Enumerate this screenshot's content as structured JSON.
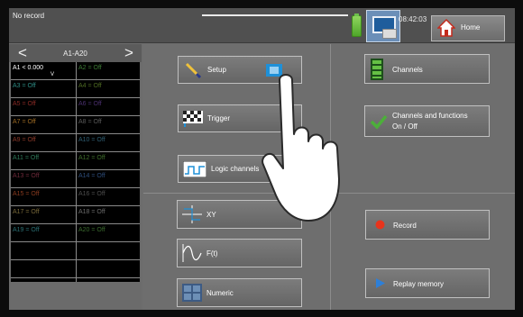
{
  "status": {
    "record_state": "No record",
    "time": "08:42:03"
  },
  "home": {
    "label": "Home"
  },
  "channels_nav": {
    "title": "A1-A20",
    "prev": "<",
    "next": ">",
    "rows": [
      {
        "left": "A1 < 0.000",
        "left_sub": "V",
        "right": "A2 = Off"
      },
      {
        "left": "A3 = Off",
        "right": "A4 = Off"
      },
      {
        "left": "A5 = Off",
        "right": "A6 = Off"
      },
      {
        "left": "A7 = Off",
        "right": "A8 = Off"
      },
      {
        "left": "A9 = Off",
        "right": "A10 = Off"
      },
      {
        "left": "A11 = Off",
        "right": "A12 = Off"
      },
      {
        "left": "A13 = Off",
        "right": "A14 = Off"
      },
      {
        "left": "A15 = Off",
        "right": "A16 = Off"
      },
      {
        "left": "A17 = Off",
        "right": "A18 = Off"
      },
      {
        "left": "A19 = Off",
        "right": "A20 = Off"
      },
      {
        "left": "",
        "right": ""
      },
      {
        "left": "",
        "right": ""
      }
    ]
  },
  "menu": {
    "setup": "Setup",
    "trigger": "Trigger",
    "logic_channels": "Logic channels",
    "channels": "Channels",
    "channels_functions_line1": "Channels and functions",
    "channels_functions_line2": "On / Off",
    "xy": "XY",
    "ft": "F(t)",
    "numeric": "Numeric",
    "record": "Record",
    "replay_memory": "Replay memory"
  },
  "colors": {
    "accent_green": "#4caf3a",
    "record_red": "#e8341c",
    "replay_blue": "#2d7fd8"
  }
}
